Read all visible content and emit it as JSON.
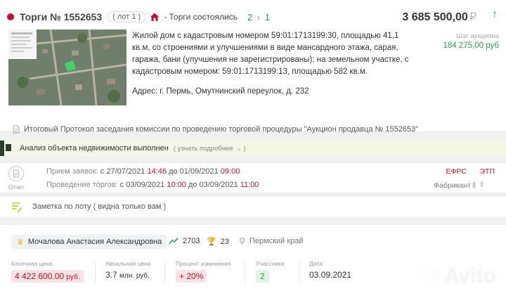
{
  "header": {
    "title": "Торги № 1552653",
    "lot": "( лот 1 )",
    "status": "- Торги состоялись",
    "steps_a": "2",
    "steps_sep": "›",
    "steps_b": "1",
    "price": "3 685 500,00",
    "currency": "₽",
    "arrow": "↑"
  },
  "lot": {
    "description": "Жилой дом с кадастровым номером 59:01:1713199:30, площадью 41,1 кв.м, со строениями и улучшениями в виде мансардного этажа, сарая, гаража, бани (улучшения не зарегистрированы); на земельном участке, с кадастровым номером: 59:01:1713199:13, площадью 582 кв.м.",
    "address": "Адрес: г. Пермь, Омутнинский переулок, д. 232",
    "step_label": "Шаг аукциона",
    "step_value": "184 275,00 руб"
  },
  "protocol": "Итоговый Протокол заседания комиссии по проведению торговой процедуры \"Аукцион продавца № 1552653\"",
  "analysis": {
    "text": "Анализ объекта недвижимости выполнен",
    "link": "( узнать подробнее → )"
  },
  "dates": {
    "doc_label": "Отчет",
    "accept_label": "Прием заявок:",
    "accept_from_pre": "с 27/07/2021",
    "accept_from_time": "14:46",
    "accept_to_pre": "до 01/09/2021",
    "accept_to_time": "09:00",
    "trade_label": "Проведение торгов:",
    "trade_from_pre": "с 03/09/2021",
    "trade_from_time": "10:00",
    "trade_to_pre": "до 03/09/2021",
    "trade_to_time": "11:00",
    "efrs": "ЕФРС",
    "etp": "ЭТП",
    "fabricant": "Фабрикант"
  },
  "note": {
    "text": "Заметка по лоту ( видна только вам )"
  },
  "owner": {
    "name": "Мочалова Анастасия Александровна",
    "views": "2703",
    "wins": "23",
    "region": "Пермский край"
  },
  "results": {
    "final_label": "Конечная цена",
    "final_value": "4 422 600.00",
    "final_unit": "руб.",
    "start_label": "Начальная цена",
    "start_value": "3.7",
    "start_unit": "млн. руб.",
    "change_label": "Процент изменения",
    "change_value": "+ 20%",
    "participants_label": "Участники",
    "participants_value": "2",
    "date_label": "Дата",
    "date_value": "03.09.2021"
  },
  "watermark": "Avito"
}
